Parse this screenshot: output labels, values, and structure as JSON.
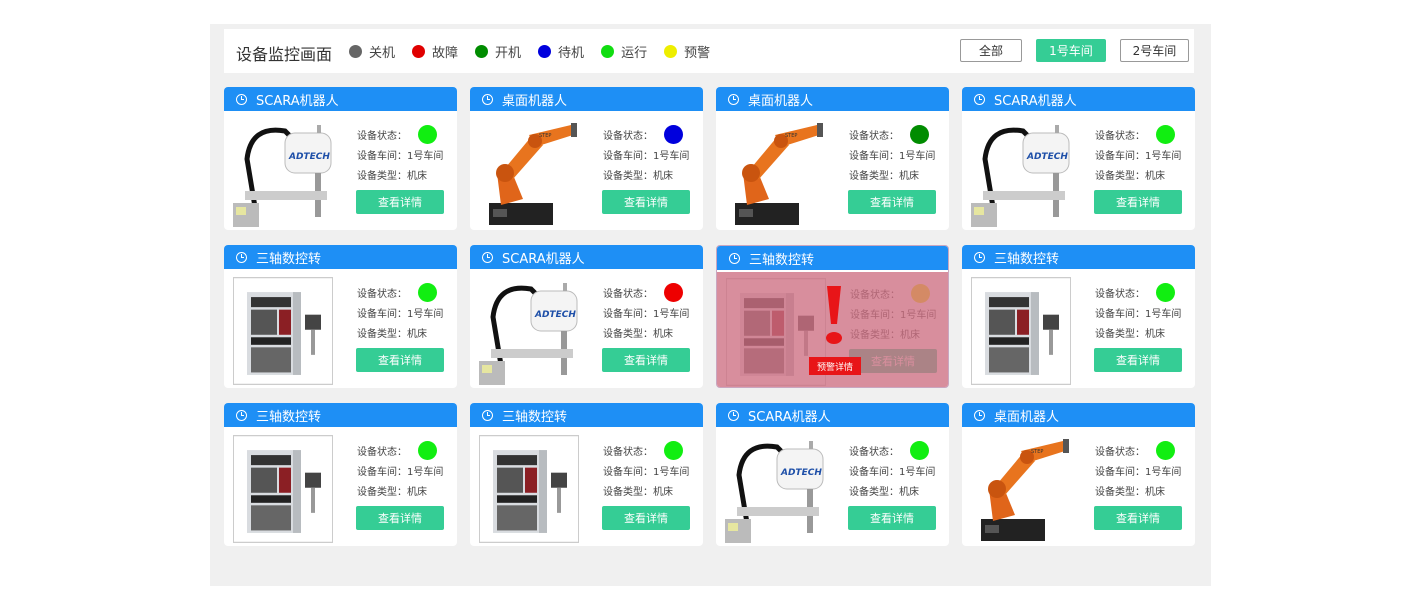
{
  "header": {
    "title": "设备监控画面",
    "legend": [
      {
        "label": "关机",
        "color": "#666666"
      },
      {
        "label": "故障",
        "color": "#e00000"
      },
      {
        "label": "开机",
        "color": "#008c00"
      },
      {
        "label": "待机",
        "color": "#0000dd"
      },
      {
        "label": "运行",
        "color": "#11dd11"
      },
      {
        "label": "预警",
        "color": "#eeee00"
      }
    ],
    "filters": [
      {
        "label": "全部",
        "active": false
      },
      {
        "label": "1号车间",
        "active": true
      },
      {
        "label": "2号车间",
        "active": false
      }
    ]
  },
  "labels": {
    "status": "设备状态：",
    "workshop": "设备车间：1号车间",
    "type": "设备类型：机床",
    "detail_button": "查看详情",
    "alarm_button": "预警详情"
  },
  "icons": {
    "clock": "clock-icon",
    "alarm": "exclamation-icon"
  },
  "cards": [
    {
      "name": "SCARA机器人",
      "image": "scara-robot",
      "status_color": "#11ee11"
    },
    {
      "name": "桌面机器人",
      "image": "industrial-arm-robot",
      "status_color": "#0000dd"
    },
    {
      "name": "桌面机器人",
      "image": "industrial-arm-robot",
      "status_color": "#008c00"
    },
    {
      "name": "SCARA机器人",
      "image": "scara-robot",
      "status_color": "#11ee11"
    },
    {
      "name": "三轴数控转",
      "image": "cnc-machine",
      "status_color": "#11ee11"
    },
    {
      "name": "SCARA机器人",
      "image": "scara-robot",
      "status_color": "#ee0000"
    },
    {
      "name": "三轴数控转",
      "image": "cnc-machine",
      "status_color": "#eeee00",
      "alarm": true
    },
    {
      "name": "三轴数控转",
      "image": "cnc-machine",
      "status_color": "#11ee11"
    },
    {
      "name": "三轴数控转",
      "image": "cnc-machine",
      "status_color": "#11ee11"
    },
    {
      "name": "三轴数控转",
      "image": "cnc-machine",
      "status_color": "#11ee11"
    },
    {
      "name": "SCARA机器人",
      "image": "scara-robot",
      "status_color": "#11ee11"
    },
    {
      "name": "桌面机器人",
      "image": "industrial-arm-robot",
      "status_color": "#11ee11"
    }
  ]
}
